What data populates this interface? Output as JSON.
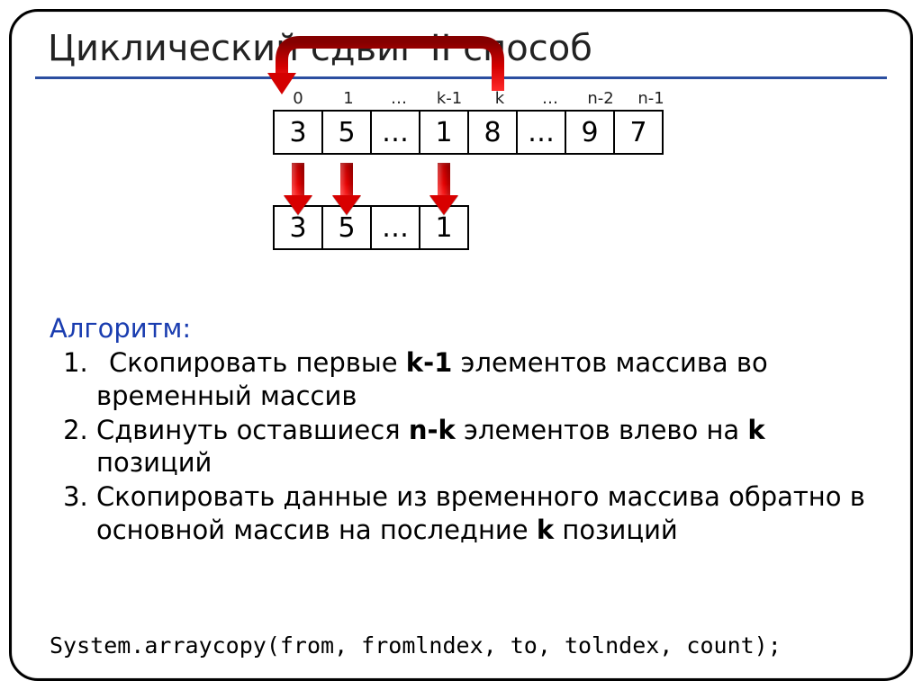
{
  "title": "Циклический сдвиг II способ",
  "indices": [
    "0",
    "1",
    "…",
    "k-1",
    "k",
    "…",
    "n-2",
    "n-1"
  ],
  "main_array": [
    "3",
    "5",
    "…",
    "1",
    "8",
    "…",
    "9",
    "7"
  ],
  "temp_array": [
    "3",
    "5",
    "…",
    "1"
  ],
  "algo_label": "Алгоритм:",
  "step1_a": "Скопировать первые ",
  "step1_b": "k-1",
  "step1_c": " элементов массива во временный массив",
  "step2_a": "Сдвинуть оставшиеся ",
  "step2_b": "n-k",
  "step2_c": " элементов влево на ",
  "step2_d": "k",
  "step2_e": " позиций",
  "step3_a": "Скопировать данные из временного массива обратно в основной массив на последние ",
  "step3_b": "k",
  "step3_c": " позиций",
  "code": "System.arraycopy(from, fromlndex, to, tolndex, count);"
}
